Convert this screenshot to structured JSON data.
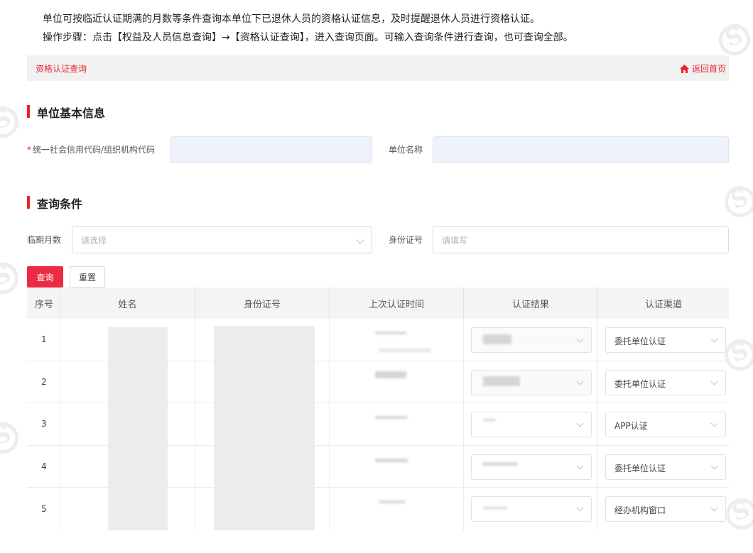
{
  "intro": {
    "line1": "单位可按临近认证期满的月数等条件查询本单位下已退休人员的资格认证信息，及时提醒退休人员进行资格认证。",
    "line2": "操作步骤：点击【权益及人员信息查询】→【资格认证查询】，进入查询页面。可输入查询条件进行查询，也可查询全部。"
  },
  "topbar": {
    "title": "资格认证查询",
    "home_label": "返回首页",
    "accent": "#e8242f"
  },
  "basic_info": {
    "section_title": "单位基本信息",
    "credit_code_label": "统一社会信用代码/组织机构代码",
    "unit_name_label": "单位名称"
  },
  "query": {
    "section_title": "查询条件",
    "months_label": "临期月数",
    "months_placeholder": "请选择",
    "id_label": "身份证号",
    "id_placeholder": "请填写",
    "search_button": "查询",
    "reset_button": "重置"
  },
  "table": {
    "headers": [
      "序号",
      "姓名",
      "身份证号",
      "上次认证时间",
      "认证结果",
      "认证渠道"
    ],
    "rows": [
      {
        "index": "1",
        "channel": "委托单位认证"
      },
      {
        "index": "2",
        "channel": "委托单位认证"
      },
      {
        "index": "3",
        "channel": "APP认证"
      },
      {
        "index": "4",
        "channel": "委托单位认证"
      },
      {
        "index": "5",
        "channel": "经办机构窗口"
      }
    ]
  }
}
